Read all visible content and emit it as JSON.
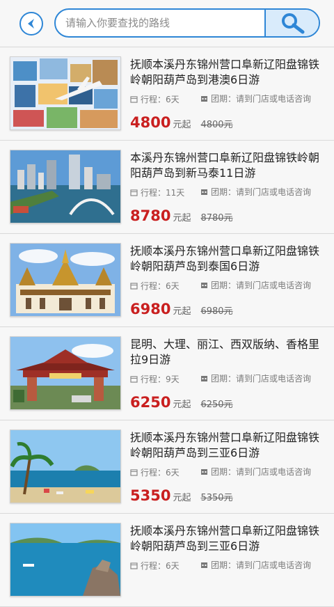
{
  "search": {
    "placeholder": "请输入你要查找的路线"
  },
  "colors": {
    "accent": "#2e86d6",
    "price": "#c91f1f"
  },
  "icons": {
    "back": "back-arrow-icon",
    "search": "search-icon",
    "duration": "calendar-icon",
    "group": "group-calendar-icon"
  },
  "items": [
    {
      "title": "抚顺本溪丹东锦州营口阜新辽阳盘锦铁岭朝阳葫芦岛到港澳6日游",
      "duration": "行程：6天",
      "group": "团期：请到门店或电话咨询",
      "price": "4800",
      "unit": "元起",
      "old_price": "4800元"
    },
    {
      "title": "本溪丹东锦州营口阜新辽阳盘锦铁岭朝阳葫芦岛到新马泰11日游",
      "duration": "行程：11天",
      "group": "团期：请到门店或电话咨询",
      "price": "8780",
      "unit": "元起",
      "old_price": "8780元"
    },
    {
      "title": "抚顺本溪丹东锦州营口阜新辽阳盘锦铁岭朝阳葫芦岛到泰国6日游",
      "duration": "行程：6天",
      "group": "团期：请到门店或电话咨询",
      "price": "6980",
      "unit": "元起",
      "old_price": "6980元"
    },
    {
      "title": "昆明、大理、丽江、西双版纳、香格里拉9日游",
      "duration": "行程：9天",
      "group": "团期：请到门店或电话咨询",
      "price": "6250",
      "unit": "元起",
      "old_price": "6250元"
    },
    {
      "title": "抚顺本溪丹东锦州营口阜新辽阳盘锦铁岭朝阳葫芦岛到三亚6日游",
      "duration": "行程：6天",
      "group": "团期：请到门店或电话咨询",
      "price": "5350",
      "unit": "元起",
      "old_price": "5350元"
    },
    {
      "title": "抚顺本溪丹东锦州营口阜新辽阳盘锦铁岭朝阳葫芦岛到三亚6日游",
      "duration": "行程：6天",
      "group": "团期：请到门店或电话咨询",
      "price": "",
      "unit": "",
      "old_price": ""
    }
  ]
}
